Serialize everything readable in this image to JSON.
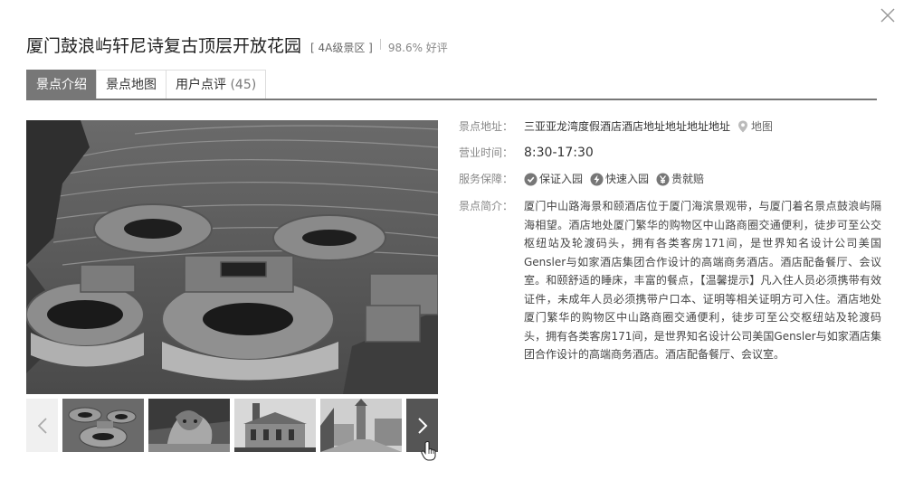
{
  "header": {
    "title": "厦门鼓浪屿轩尼诗复古顶层开放花园",
    "grade": "[ 4A级景区 ]",
    "rating": "98.6% 好评"
  },
  "tabs": [
    {
      "label": "景点介绍",
      "active": true
    },
    {
      "label": "景点地图",
      "active": false
    },
    {
      "label": "用户点评",
      "count": "(45)",
      "active": false
    }
  ],
  "info": {
    "address_label": "景点地址：",
    "address": "三亚亚龙湾度假酒店酒店地址地址地址地址",
    "map_link": "地图",
    "hours_label": "营业时间：",
    "hours": "8:30-17:30",
    "service_label": "服务保障：",
    "services": [
      {
        "label": "保证入园",
        "icon": "shield-check-icon"
      },
      {
        "label": "快速入园",
        "icon": "fast-icon"
      },
      {
        "label": "贵就赔",
        "icon": "yuan-icon"
      }
    ],
    "intro_label": "景点简介：",
    "intro": "厦门中山路海景和颐酒店位于厦门海滨景观带，与厦门着名景点鼓浪屿隔海相望。酒店地处厦门繁华的购物区中山路商圈交通便利，徒步可至公交枢纽站及轮渡码头，拥有各类客房171间，是世界知名设计公司美国Gensler与如家酒店集团合作设计的高端商务酒店。酒店配备餐厅、会议室。和颐舒适的睡床，丰富的餐点，【温馨提示】凡入住人员必须携带有效证件，未成年人员必须携带户口本、证明等相关证明方可入住。酒店地处厦门繁华的购物区中山路商圈交通便利，徒步可至公交枢纽站及轮渡码头，拥有各类客房171间，是世界知名设计公司美国Gensler与如家酒店集团合作设计的高端商务酒店。酒店配备餐厅、会议室。"
  },
  "gallery": {
    "main_photo": "tulou-aerial-photo",
    "thumbnails": [
      "tulou-aerial-thumb",
      "lion-statue-thumb",
      "colonial-building-thumb",
      "church-street-thumb"
    ]
  },
  "colors": {
    "active_tab": "#777777",
    "accent": "#555555"
  }
}
